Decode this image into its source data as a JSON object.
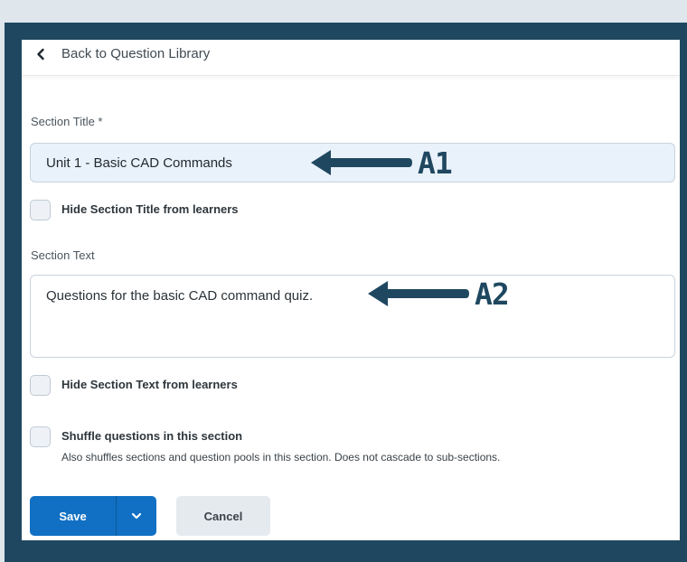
{
  "nav": {
    "back_label": "Back to Question Library"
  },
  "form": {
    "section_title_label": "Section Title *",
    "section_title_value": "Unit 1 - Basic CAD Commands",
    "hide_title_label": "Hide Section Title from learners",
    "section_text_label": "Section Text",
    "section_text_value": "Questions for the basic CAD command quiz.",
    "hide_text_label": "Hide Section Text from learners",
    "shuffle_label": "Shuffle questions in this section",
    "shuffle_desc": "Also shuffles sections and question pools in this section. Does not cascade to sub-sections."
  },
  "buttons": {
    "save_label": "Save",
    "cancel_label": "Cancel"
  },
  "annotations": {
    "a1": "A1",
    "a2": "A2"
  },
  "colors": {
    "frame": "#1f4860",
    "primary": "#1170c4",
    "input_bg": "#e9f1fb",
    "page_bg": "#dfe6ec"
  },
  "icons": {
    "back": "chevron-left-icon",
    "dropdown": "chevron-down-icon",
    "annotation_arrow": "arrow-left-icon"
  }
}
